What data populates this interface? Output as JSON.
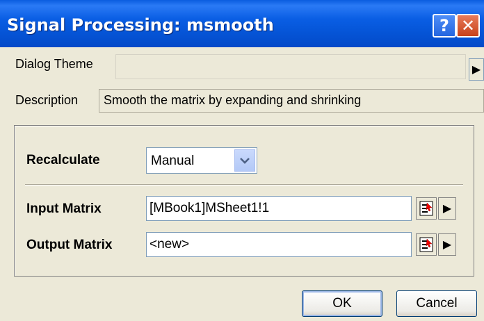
{
  "window": {
    "title": "Signal Processing: msmooth"
  },
  "titlebar_buttons": {
    "help": "?",
    "close": "✕",
    "help_icon": "help-icon",
    "close_icon": "close-icon"
  },
  "theme": {
    "label": "Dialog Theme",
    "value": "",
    "arrow": "▶"
  },
  "description": {
    "label": "Description",
    "text": "Smooth the matrix by expanding and shrinking"
  },
  "recalculate": {
    "label": "Recalculate",
    "value": "Manual"
  },
  "input_matrix": {
    "label": "Input Matrix",
    "value": "[MBook1]MSheet1!1",
    "arrow": "▶"
  },
  "output_matrix": {
    "label": "Output Matrix",
    "value": "<new>",
    "arrow": "▶"
  },
  "buttons": {
    "ok": "OK",
    "cancel": "Cancel"
  },
  "colors": {
    "titlebar": "#0554d6",
    "face": "#ece9d8",
    "close": "#c8421a",
    "input_border": "#7f9db9"
  }
}
